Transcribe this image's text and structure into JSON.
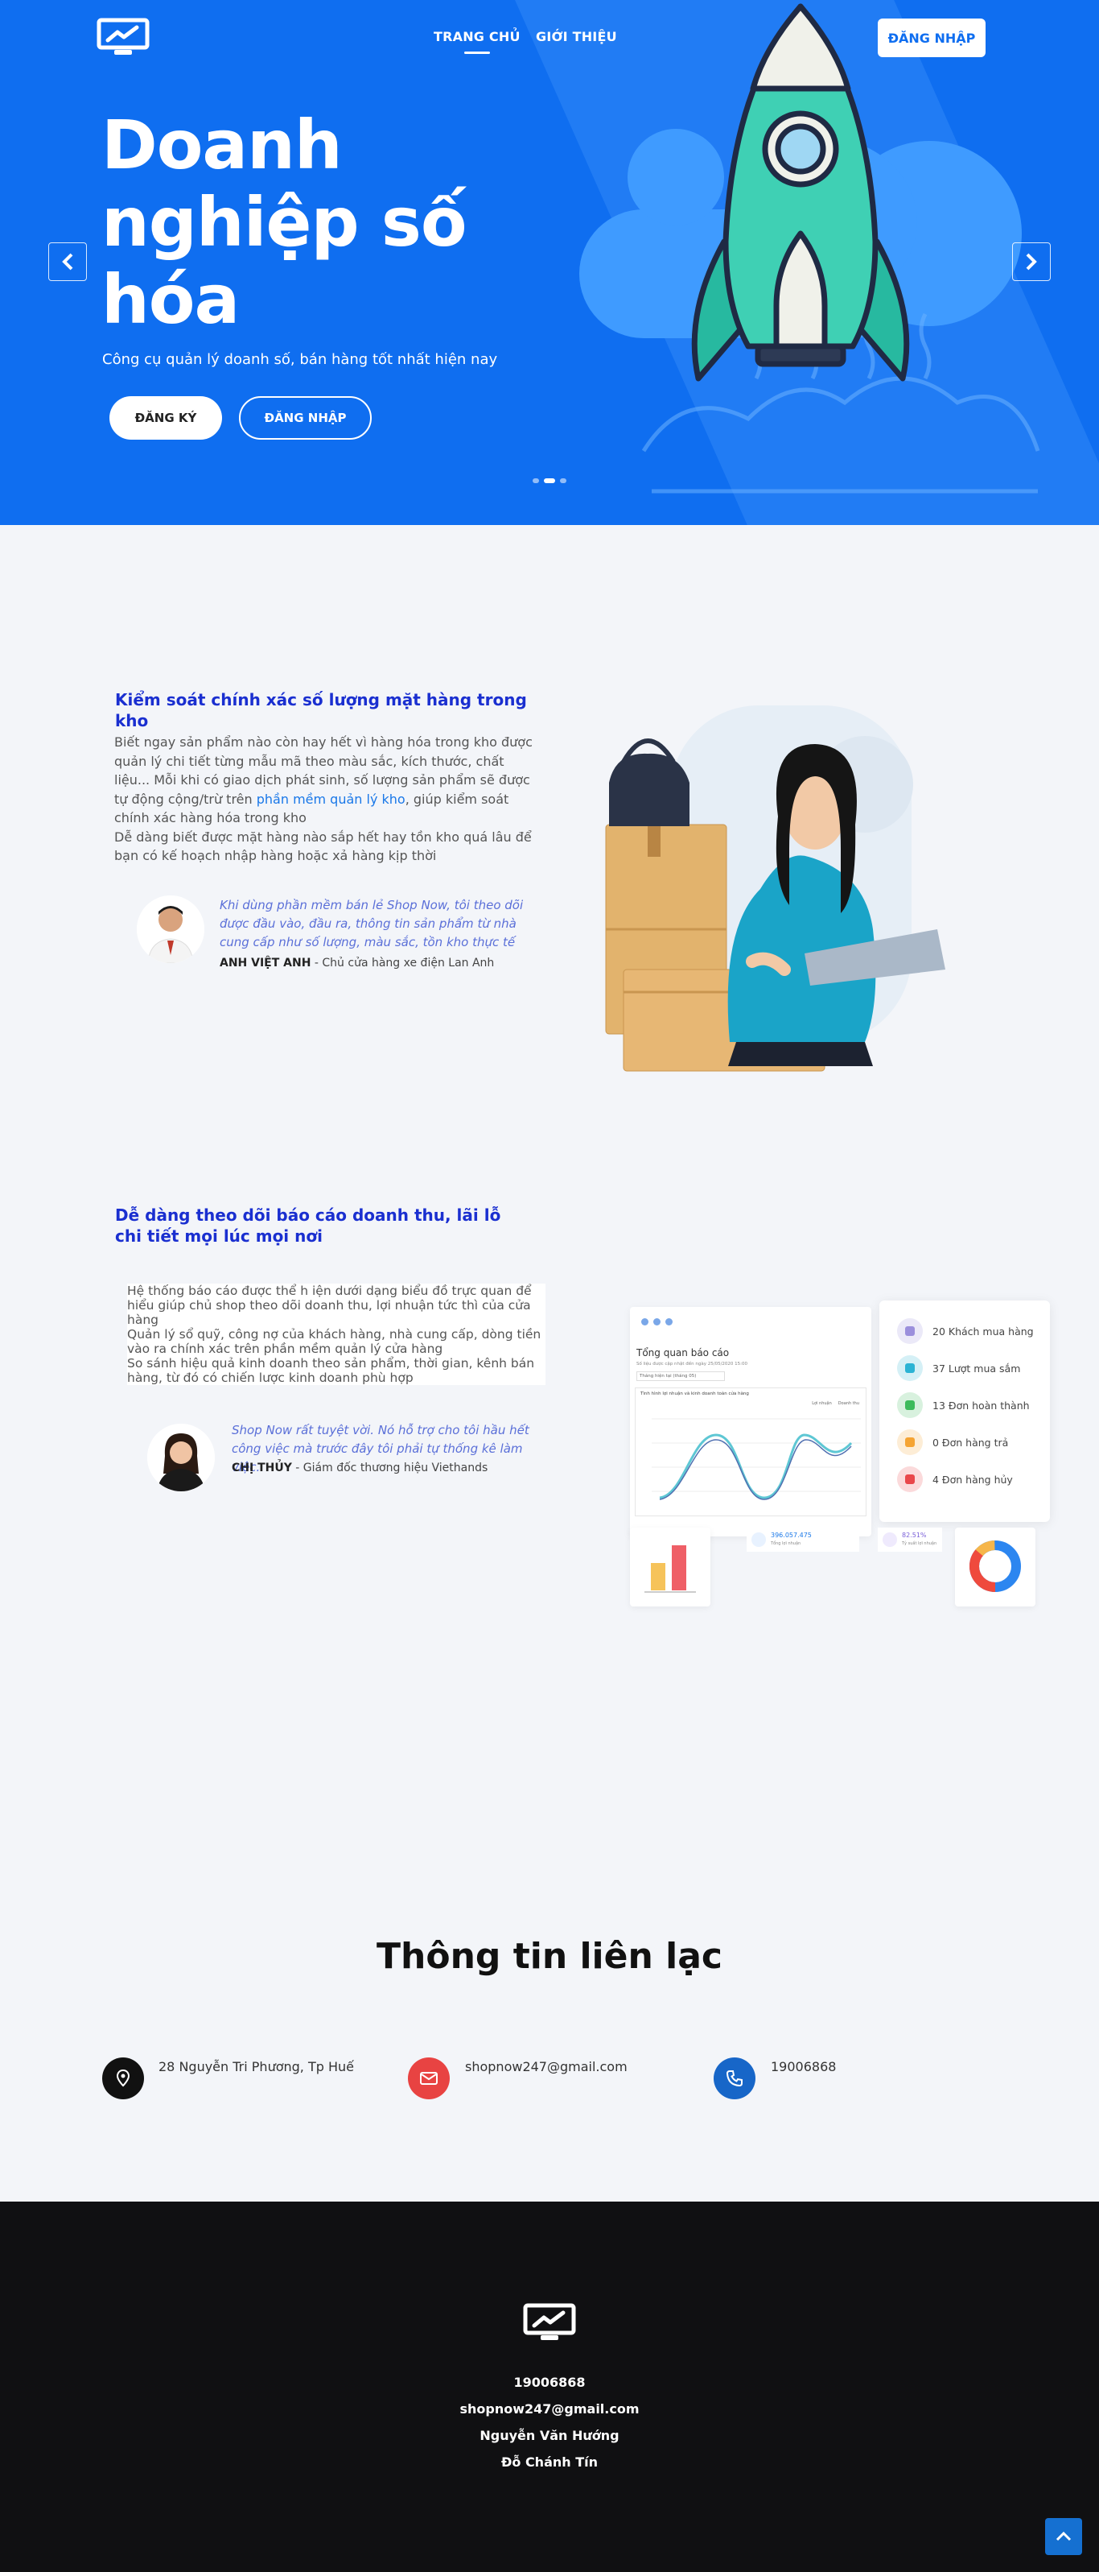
{
  "nav": {
    "links": [
      {
        "label": "TRANG CHỦ"
      },
      {
        "label": "GIỚI THIỆU"
      }
    ],
    "login": "ĐĂNG NHẬP"
  },
  "hero": {
    "title": "Doanh nghiệp số hóa",
    "subtitle": "Công cụ quản lý doanh số, bán hàng tốt nhất hiện nay",
    "register": "ĐĂNG KÝ",
    "login": "ĐĂNG NHẬP",
    "slide_count": 3,
    "active_slide": 2
  },
  "feature1": {
    "title": "Kiểm soát chính xác số lượng mặt hàng trong kho",
    "text_pre": "Biết ngay sản phẩm nào còn hay hết vì hàng hóa trong kho được quản lý chi tiết từng mẫu mã theo màu sắc, kích thước, chất liệu... Mỗi khi có giao dịch phát sinh, số lượng sản phẩm sẽ được tự động cộng/trừ trên ",
    "text_link": "phần mềm quản lý kho",
    "text_post": ", giúp kiểm soát chính xác hàng hóa trong kho",
    "text2": "Dễ dàng biết được mặt hàng nào sắp hết hay tồn kho quá lâu để bạn có kế hoạch nhập hàng hoặc xả hàng kịp thời",
    "quote": "Khi dùng phần mềm bán lẻ Shop Now, tôi theo dõi được đầu vào, đầu ra, thông tin sản phẩm từ nhà cung cấp như số lượng, màu sắc, tồn kho thực tế",
    "author_name": "ANH VIỆT ANH",
    "author_role": " - Chủ cửa hàng xe điện Lan Anh"
  },
  "feature2": {
    "title": "Dễ dàng theo dõi báo cáo doanh thu, lãi lỗ chi tiết mọi lúc mọi nơi",
    "p1": "Hệ thống báo cáo được thể h iện dưới dạng biểu đồ trực quan để hiểu giúp chủ shop theo dõi doanh thu, lợi nhuận tức thì của cửa hàng",
    "p2": "Quản lý sổ quỹ, công nợ của khách hàng, nhà cung cấp, dòng tiền vào ra chính xác trên phần mềm quản lý cửa hàng",
    "p3": "So sánh hiệu quả kinh doanh theo sản phẩm, thời gian, kênh bán hàng, từ đó có chiến lược kinh doanh phù hợp",
    "quote": "Shop Now rất tuyệt vời. Nó hỗ trợ cho tôi hầu hết công việc mà trước đây tôi phải tự thống kê làm việc.",
    "author_name": "CHỊ THỦY",
    "author_role": " - Giám đốc thương hiệu Viethands",
    "dashboard": {
      "title": "Tổng quan báo cáo",
      "caption": "Số liệu được cập nhật đến ngày 25/05/2020 15:00",
      "filter": "Tháng hiện tại (tháng 05)",
      "chart_title": "Tình hình lợi nhuận và kinh doanh toàn cửa hàng",
      "legend": [
        "Lợi nhuận",
        "Doanh thu"
      ],
      "stats": [
        {
          "label": "20 Khách mua hàng",
          "color": "#9b8fdc",
          "icon": "user-icon"
        },
        {
          "label": "37 Lượt mua sắm",
          "color": "#2bb3d4",
          "icon": "cart-icon"
        },
        {
          "label": "13 Đơn hoàn thành",
          "color": "#3dbb5b",
          "icon": "document-icon"
        },
        {
          "label": "0 Đơn hàng trả",
          "color": "#f5a433",
          "icon": "return-icon"
        },
        {
          "label": "4 Đơn hàng hủy",
          "color": "#e9474b",
          "icon": "cancel-icon"
        }
      ],
      "total_value": "396.057.475",
      "total_label": "Tổng lợi nhuận",
      "percent_value": "82.51%",
      "percent_label": "Tỷ suất lợi nhuận"
    }
  },
  "contact": {
    "title": "Thông tin liên lạc",
    "address": "28 Nguyễn Tri Phương, Tp Huế",
    "email": "shopnow247@gmail.com",
    "phone": "19006868"
  },
  "footer": {
    "phone": "19006868",
    "email": "shopnow247@gmail.com",
    "name1": "Nguyễn Văn Hướng",
    "name2": "Đỗ Chánh Tín"
  },
  "colors": {
    "primary": "#0f6ef0",
    "feature_title": "#1a2fd0",
    "footer_bg": "#101012"
  }
}
